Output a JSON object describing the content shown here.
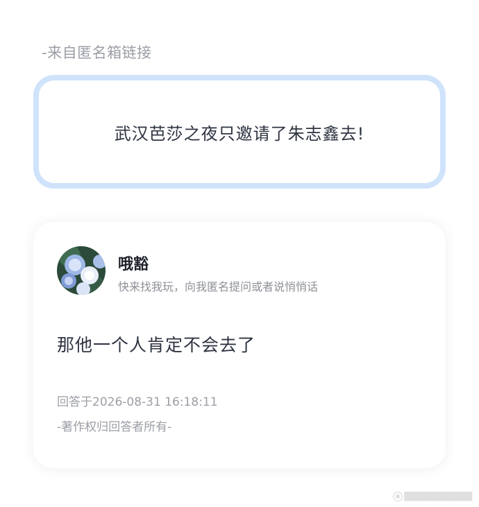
{
  "source": {
    "label": "-来自匿名箱链接"
  },
  "question": {
    "text": "武汉芭莎之夜只邀请了朱志鑫去!"
  },
  "answer": {
    "user_name": "哦豁",
    "user_bio": "快来找我玩，向我匿名提问或者说悄悄话",
    "text": "那他一个人肯定不会去了",
    "time": "回答于2026-08-31 16:18:11",
    "copyright": "-著作权归回答者所有-"
  },
  "watermark": {
    "logo": "weibo-logo-icon",
    "handle": "▇▇▇▇▇▇▇▇▇▇▇▇"
  },
  "colors": {
    "question_border": "#cfe3fb",
    "primary_text": "#2d3340",
    "secondary_text": "#9b9ea5"
  }
}
